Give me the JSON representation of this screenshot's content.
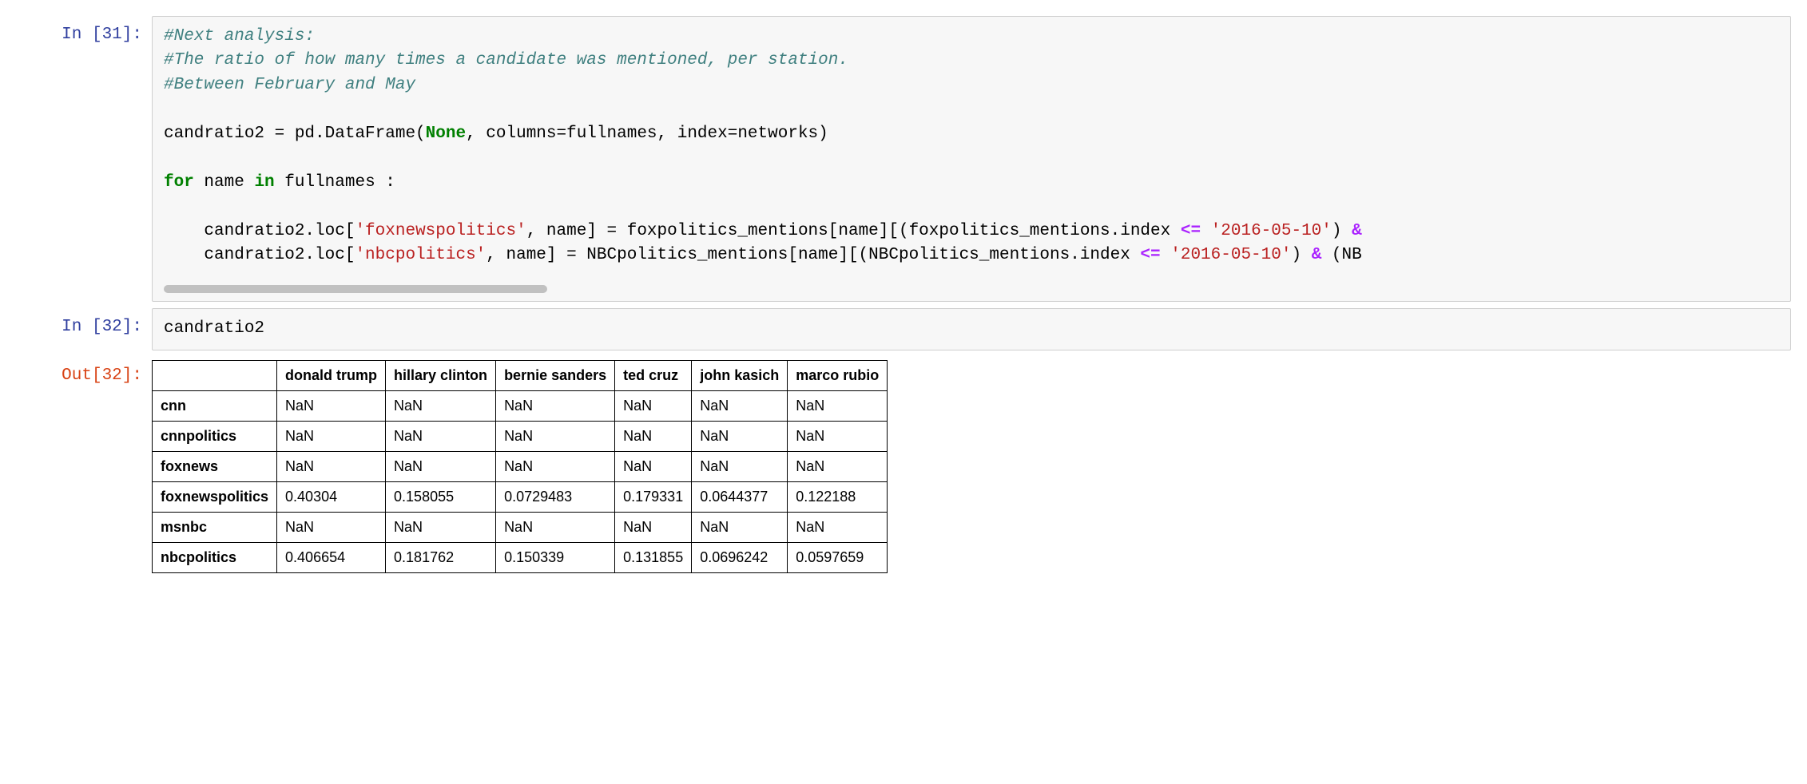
{
  "cells": [
    {
      "prompt_in": "In [31]:",
      "comment1": "#Next analysis:",
      "comment2": "#The ratio of how many times a candidate was mentioned, per station.",
      "comment3": "#Between February and May",
      "assign_lhs": "candratio2 = pd.DataFrame(",
      "none_kw": "None",
      "assign_rhs": ", columns=fullnames, index=networks)",
      "for_kw": "for",
      "for_mid": " name ",
      "in_kw": "in",
      "for_tail": " fullnames :",
      "loc1_pre": "    candratio2.loc[",
      "loc1_str": "'foxnewspolitics'",
      "loc1_mid": ", name] = foxpolitics_mentions[name][(foxpolitics_mentions.index ",
      "op_le": "<=",
      "loc1_date": " '2016-05-10'",
      "loc1_tail": ") ",
      "amp": "&",
      "loc2_pre": "    candratio2.loc[",
      "loc2_str": "'nbcpolitics'",
      "loc2_mid": ", name] = NBCpolitics_mentions[name][(NBCpolitics_mentions.index ",
      "loc2_date": " '2016-05-10'",
      "loc2_tail": ") ",
      "loc2_trunc": " (NB"
    },
    {
      "prompt_in": "In [32]:",
      "code": "candratio2",
      "prompt_out": "Out[32]:",
      "table": {
        "columns": [
          "donald trump",
          "hillary clinton",
          "bernie sanders",
          "ted cruz",
          "john kasich",
          "marco rubio"
        ],
        "index": [
          "cnn",
          "cnnpolitics",
          "foxnews",
          "foxnewspolitics",
          "msnbc",
          "nbcpolitics"
        ],
        "rows": [
          [
            "NaN",
            "NaN",
            "NaN",
            "NaN",
            "NaN",
            "NaN"
          ],
          [
            "NaN",
            "NaN",
            "NaN",
            "NaN",
            "NaN",
            "NaN"
          ],
          [
            "NaN",
            "NaN",
            "NaN",
            "NaN",
            "NaN",
            "NaN"
          ],
          [
            "0.40304",
            "0.158055",
            "0.0729483",
            "0.179331",
            "0.0644377",
            "0.122188"
          ],
          [
            "NaN",
            "NaN",
            "NaN",
            "NaN",
            "NaN",
            "NaN"
          ],
          [
            "0.406654",
            "0.181762",
            "0.150339",
            "0.131855",
            "0.0696242",
            "0.0597659"
          ]
        ]
      }
    }
  ]
}
